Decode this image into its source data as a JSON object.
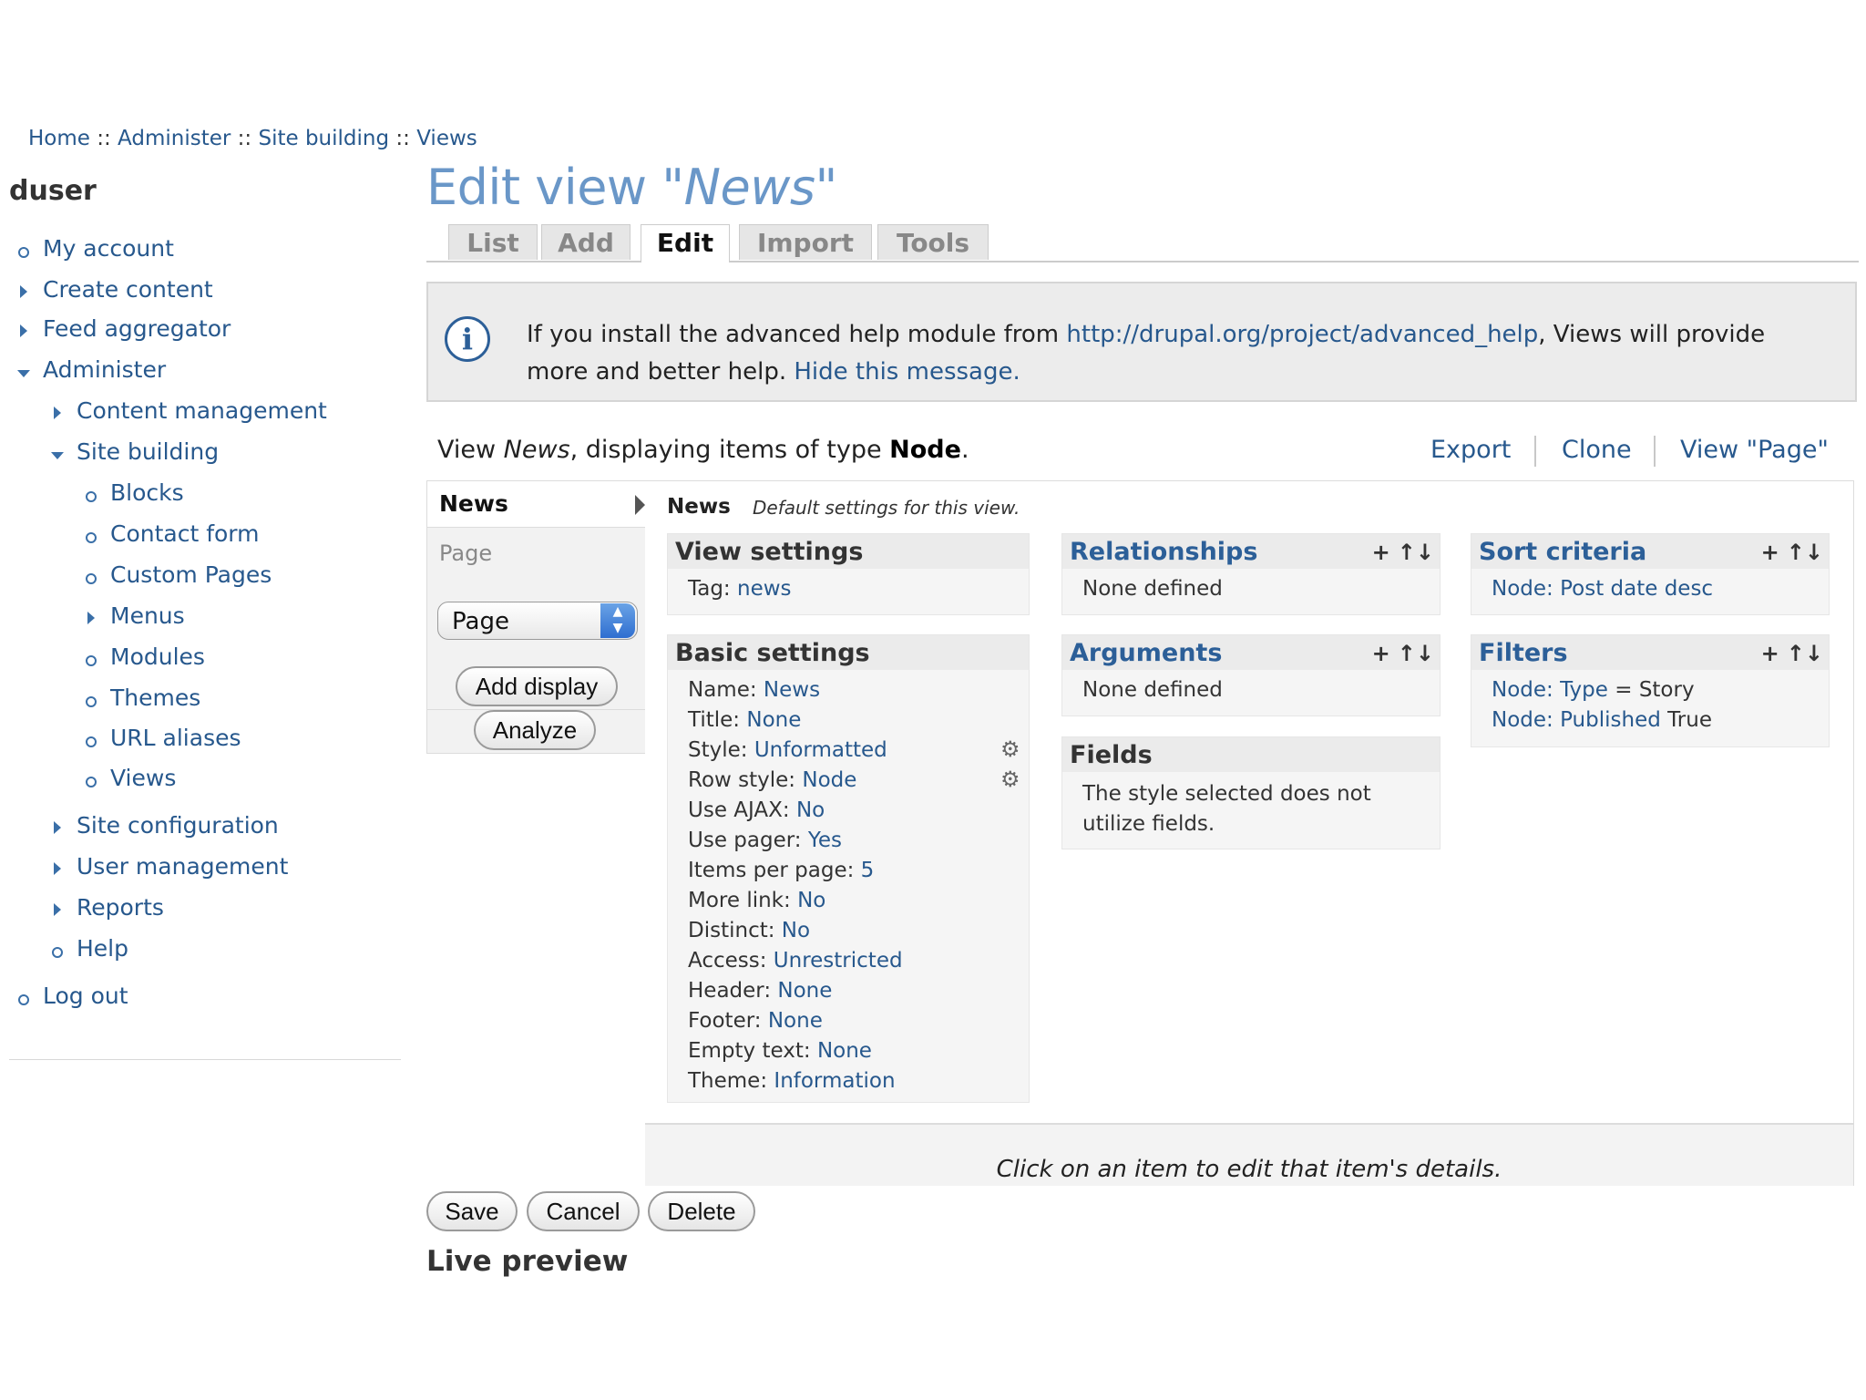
{
  "breadcrumb": {
    "items": [
      "Home",
      "Administer",
      "Site building",
      "Views"
    ],
    "separator": "::"
  },
  "sidebar": {
    "username": "duser",
    "items": [
      {
        "label": "My account",
        "marker": "bullet"
      },
      {
        "label": "Create content",
        "marker": "collapsed"
      },
      {
        "label": "Feed aggregator",
        "marker": "collapsed"
      },
      {
        "label": "Administer",
        "marker": "expanded"
      },
      {
        "label": "Content management",
        "marker": "collapsed"
      },
      {
        "label": "Site building",
        "marker": "expanded"
      },
      {
        "label": "Blocks",
        "marker": "bullet"
      },
      {
        "label": "Contact form",
        "marker": "bullet"
      },
      {
        "label": "Custom Pages",
        "marker": "bullet"
      },
      {
        "label": "Menus",
        "marker": "collapsed"
      },
      {
        "label": "Modules",
        "marker": "bullet"
      },
      {
        "label": "Themes",
        "marker": "bullet"
      },
      {
        "label": "URL aliases",
        "marker": "bullet"
      },
      {
        "label": "Views",
        "marker": "bullet"
      },
      {
        "label": "Site configuration",
        "marker": "collapsed"
      },
      {
        "label": "User management",
        "marker": "collapsed"
      },
      {
        "label": "Reports",
        "marker": "collapsed"
      },
      {
        "label": "Help",
        "marker": "bullet"
      },
      {
        "label": "Log out",
        "marker": "bullet"
      }
    ]
  },
  "page": {
    "title_prefix": "Edit view \"",
    "title_name": "News",
    "title_suffix": "\""
  },
  "tabs": [
    {
      "label": "List",
      "active": false
    },
    {
      "label": "Add",
      "active": false
    },
    {
      "label": "Edit",
      "active": true
    },
    {
      "label": "Import",
      "active": false
    },
    {
      "label": "Tools",
      "active": false
    }
  ],
  "help": {
    "text_before": "If you install the advanced help module from ",
    "link": "http://drupal.org/project/advanced_help",
    "text_after": ", Views will provide more and better help. ",
    "hide_link": "Hide this message."
  },
  "summary": {
    "prefix": "View ",
    "view_name": "News",
    "middle": ", displaying items of type ",
    "type": "Node",
    "suffix": "."
  },
  "header_links": [
    "Export",
    "Clone",
    "View \"Page\""
  ],
  "displays": {
    "active": "News",
    "other": "Page",
    "select_value": "Page",
    "add_display": "Add display",
    "analyze": "Analyze"
  },
  "panel": {
    "heading": "News",
    "description": "Default settings for this view.",
    "footer": "Click on an item to edit that item's details."
  },
  "view_settings": {
    "title": "View settings",
    "rows": [
      {
        "label": "Tag: ",
        "value": "news"
      }
    ]
  },
  "basic_settings": {
    "title": "Basic settings",
    "rows": [
      {
        "label": "Name: ",
        "value": "News"
      },
      {
        "label": "Title: ",
        "value": "None"
      },
      {
        "label": "Style: ",
        "value": "Unformatted"
      },
      {
        "label": "Row style: ",
        "value": "Node"
      },
      {
        "label": "Use AJAX: ",
        "value": "No"
      },
      {
        "label": "Use pager: ",
        "value": "Yes"
      },
      {
        "label": "Items per page: ",
        "value": "5"
      },
      {
        "label": "More link: ",
        "value": "No"
      },
      {
        "label": "Distinct: ",
        "value": "No"
      },
      {
        "label": "Access: ",
        "value": "Unrestricted"
      },
      {
        "label": "Header: ",
        "value": "None"
      },
      {
        "label": "Footer: ",
        "value": "None"
      },
      {
        "label": "Empty text: ",
        "value": "None"
      },
      {
        "label": "Theme: ",
        "value": "Information"
      }
    ]
  },
  "relationships": {
    "title": "Relationships",
    "text": "None defined"
  },
  "arguments": {
    "title": "Arguments",
    "text": "None defined"
  },
  "fields": {
    "title": "Fields",
    "text": "The style selected does not utilize fields."
  },
  "sort_criteria": {
    "title": "Sort criteria",
    "rows": [
      {
        "label": "Node: ",
        "value": "Post date desc"
      }
    ]
  },
  "filters": {
    "title": "Filters",
    "rows": [
      {
        "label": "Node: ",
        "value": "Type",
        "rest": " = Story"
      },
      {
        "label": "Node: ",
        "value": "Published",
        "rest": " True"
      }
    ]
  },
  "tools": {
    "add": "+",
    "rearrange": "↑↓"
  },
  "buttons": {
    "save": "Save",
    "cancel": "Cancel",
    "delete": "Delete"
  },
  "live_preview": "Live preview",
  "colors": {
    "link": "#27588d",
    "title": "#6a97c8",
    "info_icon": "#2c5f98",
    "box_header": "#ebebeb"
  }
}
